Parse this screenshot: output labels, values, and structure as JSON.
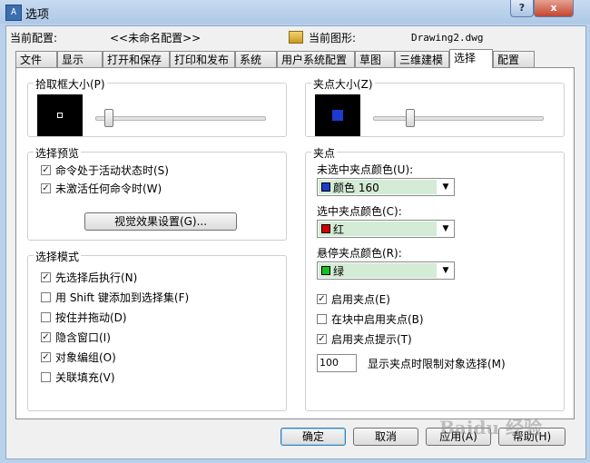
{
  "window": {
    "title": "选项",
    "app_icon": "autocad-logo-icon",
    "help_button": "?",
    "close_button": "x"
  },
  "config_bar": {
    "current_config_label": "当前配置:",
    "current_config_value": "<<未命名配置>>",
    "drawing_icon": "drawing-file-icon",
    "current_drawing_label": "当前图形:",
    "current_drawing_value": "Drawing2.dwg"
  },
  "tabs": [
    "文件",
    "显示",
    "打开和保存",
    "打印和发布",
    "系统",
    "用户系统配置",
    "草图",
    "三维建模",
    "选择",
    "配置"
  ],
  "active_tab": "选择",
  "pickbox": {
    "title": "拾取框大小(P)",
    "slider_level": 0.08
  },
  "grip_size": {
    "title": "夹点大小(Z)",
    "slider_level": 0.22
  },
  "selection_preview": {
    "title": "选择预览",
    "items": [
      {
        "label": "命令处于活动状态时(S)",
        "checked": true
      },
      {
        "label": "未激活任何命令时(W)",
        "checked": true
      }
    ],
    "visual_button": "视觉效果设置(G)..."
  },
  "selection_modes": {
    "title": "选择模式",
    "items": [
      {
        "label": "先选择后执行(N)",
        "checked": true
      },
      {
        "label": "用 Shift 键添加到选择集(F)",
        "checked": false
      },
      {
        "label": "按住并拖动(D)",
        "checked": false
      },
      {
        "label": "隐含窗口(I)",
        "checked": true
      },
      {
        "label": "对象编组(O)",
        "checked": true
      },
      {
        "label": "关联填充(V)",
        "checked": false
      }
    ]
  },
  "grips": {
    "title": "夹点",
    "unselected_label": "未选中夹点颜色(U):",
    "unselected_value": "颜色 160",
    "unselected_color": "#1c3cd0",
    "selected_label": "选中夹点颜色(C):",
    "selected_value": "红",
    "selected_color": "#d40000",
    "hover_label": "悬停夹点颜色(R):",
    "hover_value": "绿",
    "hover_color": "#19c019",
    "items": [
      {
        "label": "启用夹点(E)",
        "checked": true
      },
      {
        "label": "在块中启用夹点(B)",
        "checked": false
      },
      {
        "label": "启用夹点提示(T)",
        "checked": true
      }
    ],
    "limit_value": "100",
    "limit_label": "显示夹点时限制对象选择(M)"
  },
  "footer": {
    "ok": "确定",
    "cancel": "取消",
    "apply": "应用(A)",
    "help": "帮助(H)"
  },
  "watermark": "Baidu 经验"
}
